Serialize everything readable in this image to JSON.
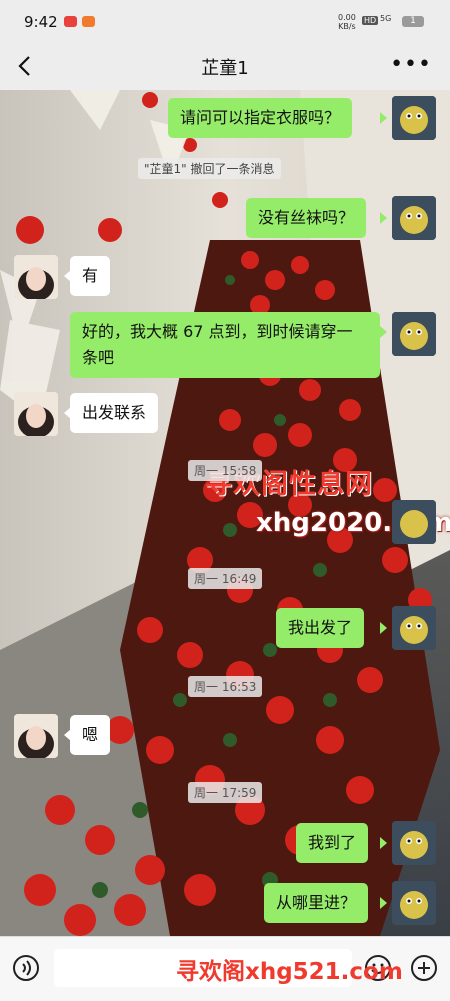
{
  "status": {
    "time": "9:42",
    "net_speed": "0.00",
    "net_unit": "KB/s",
    "hd": "HD",
    "signal": "5G",
    "battery": "1"
  },
  "header": {
    "title": "芷童1"
  },
  "messages": {
    "m1": "请问可以指定衣服吗？",
    "recall": "\"芷童1\" 撤回了一条消息",
    "m2": "没有丝袜吗？",
    "m3": "有",
    "m4": "好的，我大概 67 点到，到时候请穿一条吧",
    "m5": "出发联系",
    "t1": "周一 15:58",
    "t2": "周一 16:49",
    "m6": "我出发了",
    "t3": "周一 16:53",
    "m7": "嗯",
    "t4": "周一 17:59",
    "m8": "我到了",
    "m9": "从哪里进？"
  },
  "watermarks": {
    "w1": "寻欢阁性息网",
    "w2": "xhg2020.com",
    "w3": "寻欢阁xhg521.com"
  },
  "icons": [
    "back-icon",
    "more-icon",
    "voice-icon",
    "emoji-icon",
    "plus-icon"
  ],
  "colors": {
    "me_bubble": "#95ec69",
    "other_bubble": "#ffffff",
    "background": "#ededed"
  }
}
